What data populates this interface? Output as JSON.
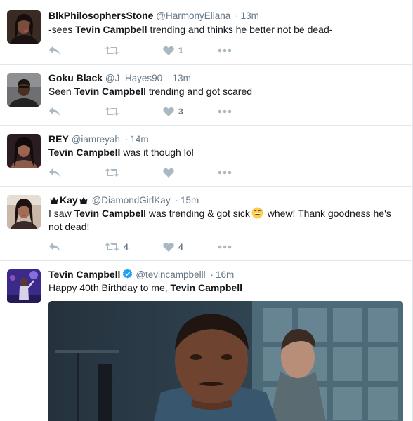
{
  "tweets": [
    {
      "name": "BlkPhilosophersStone",
      "handle": "@HarmonyEliana",
      "separator": "·",
      "time": "13m",
      "text_before": "-sees ",
      "highlight": "Tevin Campbell",
      "text_after": " trending and thinks he better not be dead-",
      "retweets": "",
      "likes": "1"
    },
    {
      "name": "Goku Black",
      "handle": "@J_Hayes90",
      "separator": "·",
      "time": "13m",
      "text_before": "Seen ",
      "highlight": "Tevin Campbell",
      "text_after": " trending and got scared",
      "retweets": "",
      "likes": "3"
    },
    {
      "name": "REY",
      "handle": "@iamreyah",
      "separator": "·",
      "time": "14m",
      "text_before": "",
      "highlight": "Tevin Campbell",
      "text_after": " was it though lol",
      "retweets": "",
      "likes": ""
    },
    {
      "name": "Kay",
      "handle": "@DiamondGirlKay",
      "separator": "·",
      "time": "15m",
      "text_before": "I saw ",
      "highlight": "Tevin Campbell",
      "text_mid": " was trending & got sick",
      "text_after": " whew! Thank goodness he's not dead!",
      "retweets": "4",
      "likes": "4"
    },
    {
      "name": "Tevin Campbell",
      "handle": "@tevincampbelll",
      "separator": "·",
      "time": "16m",
      "text_before": "Happy 40th Birthday to me, ",
      "highlight": "Tevin Campbell",
      "text_after": ""
    }
  ],
  "icons": {
    "reply": "reply-icon",
    "retweet": "retweet-icon",
    "like": "heart-icon",
    "more": "more-icon",
    "verified": "verified-badge-icon",
    "emoji": "grinning-sweat-emoji",
    "crown": "crown-icon"
  },
  "colors": {
    "name": "#14171a",
    "meta": "#657786",
    "action": "#aab8c2",
    "verified": "#1da1f2",
    "divider": "#e1e8ed"
  }
}
